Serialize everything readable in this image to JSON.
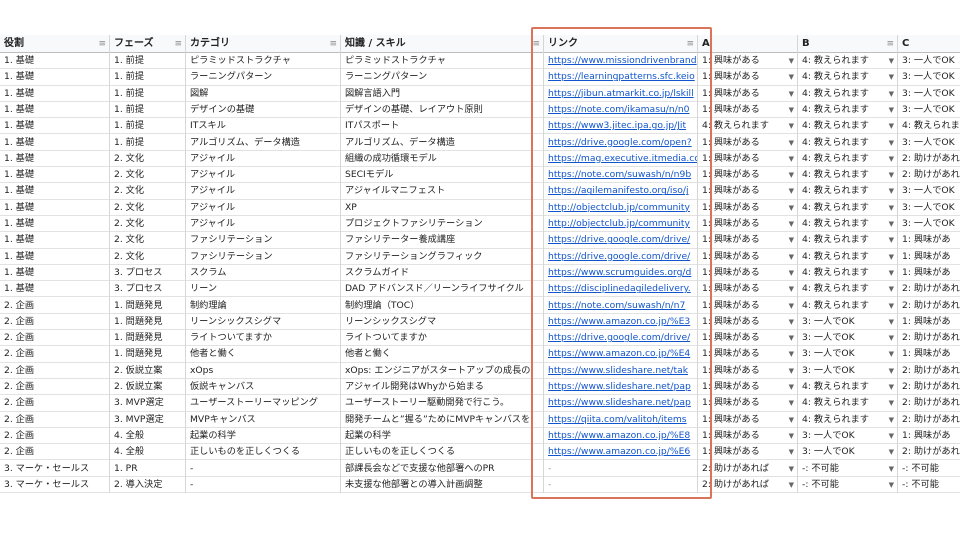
{
  "columns": [
    "役割",
    "フェーズ",
    "カテゴリ",
    "知識 / スキル",
    "リンク",
    "A",
    "B",
    "C"
  ],
  "filter_icon": "filter-icon",
  "dropdown_icon": "dropdown-arrow-icon",
  "colors": {
    "highlight": "#d9735a",
    "link": "#1155cc",
    "header_bg": "#f8f9fa"
  },
  "rows": [
    [
      "1. 基礎",
      "1. 前提",
      "ピラミッドストラクチャ",
      "ピラミッドストラクチャ",
      "https://www.missiondrivenbrand",
      "1: 興味がある",
      "4: 教えられます",
      "3: 一人でOK"
    ],
    [
      "1. 基礎",
      "1. 前提",
      "ラーニングパターン",
      "ラーニングパターン",
      "https://learningpatterns.sfc.keio",
      "1: 興味がある",
      "4: 教えられます",
      "3: 一人でOK"
    ],
    [
      "1. 基礎",
      "1. 前提",
      "図解",
      "図解言語入門",
      "https://jibun.atmarkit.co.jp/lskill",
      "1: 興味がある",
      "4: 教えられます",
      "3: 一人でOK"
    ],
    [
      "1. 基礎",
      "1. 前提",
      "デザインの基礎",
      "デザインの基礎、レイアウト原則",
      "https://note.com/ikamasu/n/n0",
      "1: 興味がある",
      "4: 教えられます",
      "3: 一人でOK"
    ],
    [
      "1. 基礎",
      "1. 前提",
      "ITスキル",
      "ITパスポート",
      "https://www3.jitec.ipa.go.jp/Jit",
      "4: 教えられます",
      "4: 教えられます",
      "4: 教えられま"
    ],
    [
      "1. 基礎",
      "1. 前提",
      "アルゴリズム、データ構造",
      "アルゴリズム、データ構造",
      "https://drive.google.com/open?",
      "1: 興味がある",
      "4: 教えられます",
      "3: 一人でOK"
    ],
    [
      "1. 基礎",
      "2. 文化",
      "アジャイル",
      "組織の成功循環モデル",
      "https://mag.executive.itmedia.co",
      "1: 興味がある",
      "4: 教えられます",
      "2: 助けがあれ"
    ],
    [
      "1. 基礎",
      "2. 文化",
      "アジャイル",
      "SECIモデル",
      "https://note.com/suwash/n/n9b",
      "1: 興味がある",
      "4: 教えられます",
      "2: 助けがあれ"
    ],
    [
      "1. 基礎",
      "2. 文化",
      "アジャイル",
      "アジャイルマニフェスト",
      "https://agilemanifesto.org/iso/j",
      "1: 興味がある",
      "4: 教えられます",
      "3: 一人でOK"
    ],
    [
      "1. 基礎",
      "2. 文化",
      "アジャイル",
      "XP",
      "http://objectclub.jp/community",
      "1: 興味がある",
      "4: 教えられます",
      "3: 一人でOK"
    ],
    [
      "1. 基礎",
      "2. 文化",
      "アジャイル",
      "プロジェクトファシリテーション",
      "http://objectclub.jp/community",
      "1: 興味がある",
      "4: 教えられます",
      "3: 一人でOK"
    ],
    [
      "1. 基礎",
      "2. 文化",
      "ファシリテーション",
      "ファシリテーター養成講座",
      "https://drive.google.com/drive/",
      "1: 興味がある",
      "4: 教えられます",
      "1: 興味があ"
    ],
    [
      "1. 基礎",
      "2. 文化",
      "ファシリテーション",
      "ファシリテーショングラフィック",
      "https://drive.google.com/drive/",
      "1: 興味がある",
      "4: 教えられます",
      "1: 興味があ"
    ],
    [
      "1. 基礎",
      "3. プロセス",
      "スクラム",
      "スクラムガイド",
      "https://www.scrumguides.org/d",
      "1: 興味がある",
      "4: 教えられます",
      "1: 興味があ"
    ],
    [
      "1. 基礎",
      "3. プロセス",
      "リーン",
      "DAD アドバンスド／リーンライフサイクル",
      "https://disciplinedagiledelivery.",
      "1: 興味がある",
      "4: 教えられます",
      "2: 助けがあれ"
    ],
    [
      "2. 企画",
      "1. 問題発見",
      "制約理論",
      "制約理論（TOC）",
      "https://note.com/suwash/n/n7",
      "1: 興味がある",
      "4: 教えられます",
      "2: 助けがあれ"
    ],
    [
      "2. 企画",
      "1. 問題発見",
      "リーンシックスシグマ",
      "リーンシックスシグマ",
      "https://www.amazon.co.jp/%E3",
      "1: 興味がある",
      "3: 一人でOK",
      "1: 興味があ"
    ],
    [
      "2. 企画",
      "1. 問題発見",
      "ライトついてますか",
      "ライトついてますか",
      "https://drive.google.com/drive/",
      "1: 興味がある",
      "3: 一人でOK",
      "2: 助けがあれ"
    ],
    [
      "2. 企画",
      "1. 問題発見",
      "他者と働く",
      "他者と働く",
      "https://www.amazon.co.jp/%E4",
      "1: 興味がある",
      "3: 一人でOK",
      "1: 興味があ"
    ],
    [
      "2. 企画",
      "2. 仮説立案",
      "xOps",
      "xOps: エンジニアがスタートアップの成長の",
      "https://www.slideshare.net/tak",
      "1: 興味がある",
      "3: 一人でOK",
      "2: 助けがあれ"
    ],
    [
      "2. 企画",
      "2. 仮説立案",
      "仮説キャンバス",
      "アジャイル開発はWhyから始まる",
      "https://www.slideshare.net/pap",
      "1: 興味がある",
      "4: 教えられます",
      "2: 助けがあれ"
    ],
    [
      "2. 企画",
      "3. MVP選定",
      "ユーザーストーリーマッピング",
      "ユーザーストーリー駆動開発で行こう。",
      "https://www.slideshare.net/pap",
      "1: 興味がある",
      "4: 教えられます",
      "2: 助けがあれ"
    ],
    [
      "2. 企画",
      "3. MVP選定",
      "MVPキャンバス",
      "開発チームと”握る”ためにMVPキャンバスを",
      "https://qiita.com/valitoh/items",
      "1: 興味がある",
      "4: 教えられます",
      "2: 助けがあれ"
    ],
    [
      "2. 企画",
      "4. 全般",
      "起業の科学",
      "起業の科学",
      "https://www.amazon.co.jp/%E8",
      "1: 興味がある",
      "3: 一人でOK",
      "1: 興味があ"
    ],
    [
      "2. 企画",
      "4. 全般",
      "正しいものを正しくつくる",
      "正しいものを正しくつくる",
      "https://www.amazon.co.jp/%E6",
      "1: 興味がある",
      "3: 一人でOK",
      "2: 助けがあれ"
    ],
    [
      "3. マーケ・セールス",
      "1. PR",
      "-",
      "部課長会などで支援な他部署へのPR",
      "-",
      "2: 助けがあれば",
      "-: 不可能",
      "-: 不可能"
    ],
    [
      "3. マーケ・セールス",
      "2. 導入決定",
      "-",
      "未支援な他部署との導入計画調整",
      "-",
      "2: 助けがあれば",
      "-: 不可能",
      "-: 不可能"
    ]
  ]
}
